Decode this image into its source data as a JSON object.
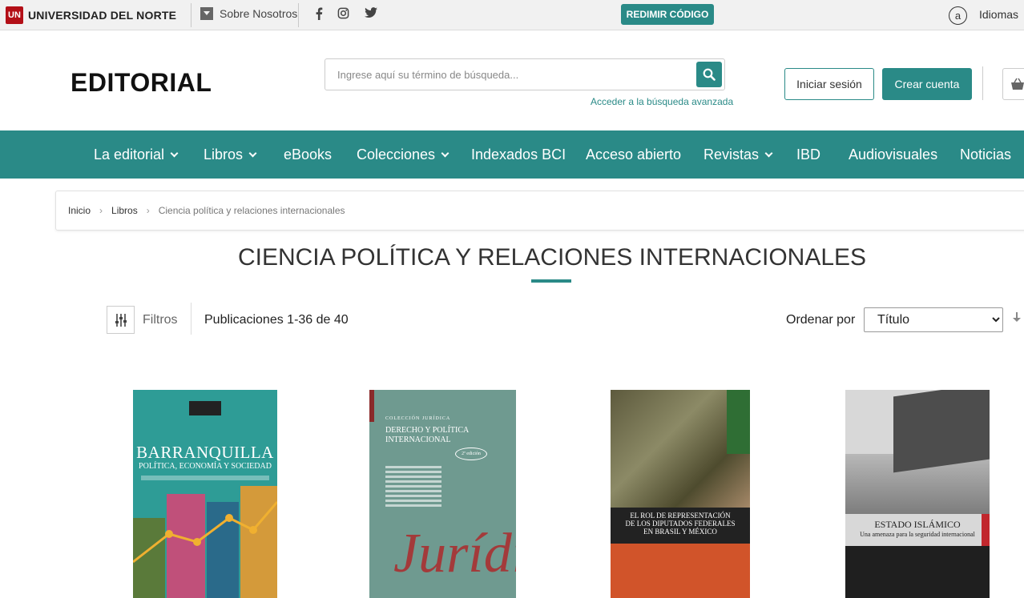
{
  "topbar": {
    "university_name": "UNIVERSIDAD DEL NORTE",
    "university_mark": "UN",
    "about_label": "Sobre Nosotros",
    "social": [
      "facebook-icon",
      "instagram-icon",
      "twitter-icon"
    ],
    "redeem_label": "REDIMIR CÓDIGO",
    "language_icon": "a",
    "language_label": "Idiomas"
  },
  "header": {
    "brand": "EDITORIAL",
    "search_placeholder": "Ingrese aquí su término de búsqueda...",
    "advanced_search_label": "Acceder a la búsqueda avanzada",
    "login_label": "Iniciar sesión",
    "signup_label": "Crear cuenta"
  },
  "nav": {
    "items": [
      {
        "label": "La editorial",
        "dropdown": true
      },
      {
        "label": "Libros",
        "dropdown": true
      },
      {
        "label": "eBooks",
        "dropdown": false
      },
      {
        "label": "Colecciones",
        "dropdown": true
      },
      {
        "label": "Indexados BCI",
        "dropdown": false
      },
      {
        "label": "Acceso abierto",
        "dropdown": false
      },
      {
        "label": "Revistas",
        "dropdown": true
      },
      {
        "label": "IBD",
        "dropdown": false
      },
      {
        "label": "Audiovisuales",
        "dropdown": false
      },
      {
        "label": "Noticias",
        "dropdown": false
      }
    ]
  },
  "breadcrumb": {
    "items": [
      "Inicio",
      "Libros",
      "Ciencia política y relaciones internacionales"
    ]
  },
  "page": {
    "title": "CIENCIA POLÍTICA Y RELACIONES INTERNACIONALES"
  },
  "toolbar": {
    "filters_label": "Filtros",
    "publications_count": "Publicaciones 1-36 de 40",
    "sort_label": "Ordenar por",
    "sort_selected": "Título"
  },
  "books": [
    {
      "title": "BARRANQUILLA",
      "subtitle": "POLÍTICA, ECONOMÍA Y SOCIEDAD"
    },
    {
      "collection": "COLECCIÓN JURÍDICA",
      "title": "DERECHO Y POLÍTICA INTERNACIONAL",
      "edition": "2ª edición",
      "script": "Jurídi"
    },
    {
      "title": "EL ROL DE REPRESENTACIÓN DE LOS DIPUTADOS FEDERALES EN BRASIL Y MÉXICO"
    },
    {
      "title": "ESTADO ISLÁMICO",
      "subtitle": "Una amenaza para la seguridad internacional"
    }
  ],
  "colors": {
    "accent": "#2a8a87",
    "brand_red": "#b30f17"
  }
}
